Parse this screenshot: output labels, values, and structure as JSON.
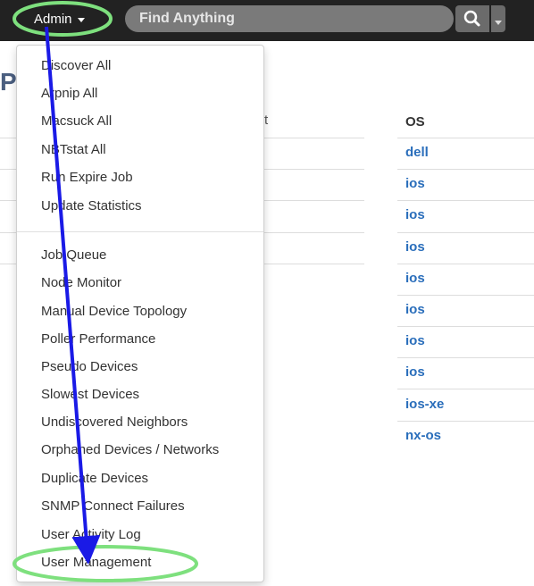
{
  "navbar": {
    "admin_label": "Admin",
    "search_placeholder": "Find Anything",
    "search_icon": "search-icon"
  },
  "page": {
    "title": "P",
    "column_fragment": "t"
  },
  "table": {
    "os_header": "OS",
    "os_values": [
      "dell",
      "ios",
      "ios",
      "ios",
      "ios",
      "ios",
      "ios",
      "ios",
      "ios-xe",
      "nx-os"
    ]
  },
  "menu": {
    "group1": [
      "Discover All",
      "Arpnip All",
      "Macsuck All",
      "NBTstat All",
      "Run Expire Job",
      "Update Statistics"
    ],
    "group2": [
      "Job Queue",
      "Node Monitor",
      "Manual Device Topology",
      "Poller Performance",
      "Pseudo Devices",
      "Slowest Devices",
      "Undiscovered Neighbors",
      "Orphaned Devices / Networks",
      "Duplicate Devices",
      "SNMP Connect Failures",
      "User Activity Log",
      "User Management"
    ]
  },
  "annotation": {
    "highlight_color": "#7ee07e",
    "arrow_color": "#1a1ae6"
  }
}
